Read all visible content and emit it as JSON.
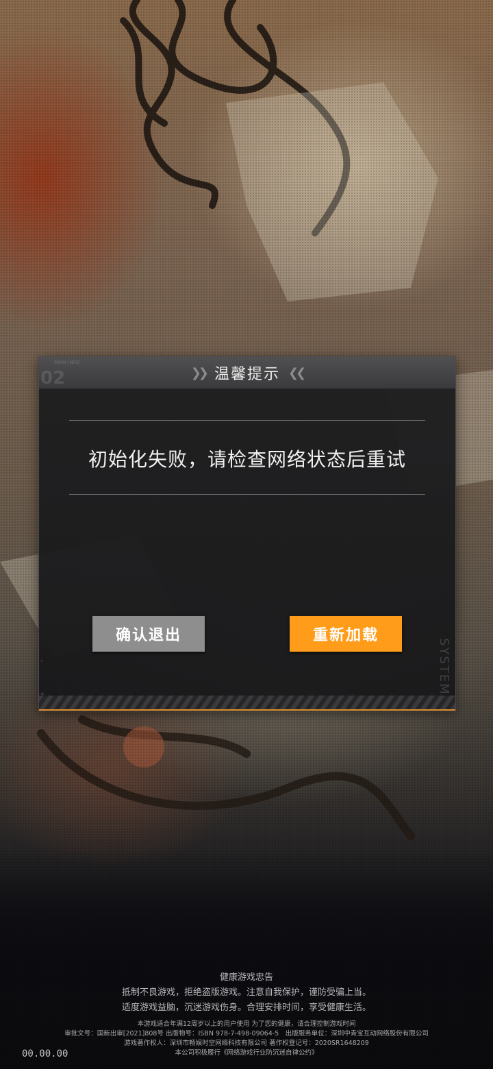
{
  "dialog": {
    "title": "温馨提示",
    "header_number": "02",
    "header_tag": "MAIN INFO",
    "message": "初始化失败，请检查网络状态后重试",
    "exit_button": "确认退出",
    "reload_button": "重新加载",
    "side_label": "SYSTEM"
  },
  "footer": {
    "notice_title": "健康游戏忠告",
    "notice_line1": "抵制不良游戏，拒绝盗版游戏。注意自我保护，谨防受骗上当。",
    "notice_line2": "适度游戏益脑，沉迷游戏伤身。合理安排时间，享受健康生活。",
    "age_notice": "本游戏适合年满12周岁以上的用户使用 为了您的健康，请合理控制游戏时间",
    "approval": "审批文号：国新出审[2021]808号 出版物号：ISBN 978-7-498-09064-5　出版服务单位：深圳中青宝互动网络股份有限公司",
    "copyright": "游戏著作权人：深圳市畅娱时空网络科技有限公司 著作权登记号：2020SR1648209",
    "pledge": "本公司积极履行《网络游戏行业防沉迷自律公约》"
  },
  "version": "00.00.00",
  "colors": {
    "accent": "#ff9c1a",
    "exit_button_bg": "#8e8e8e",
    "dialog_bg": "#1e1e20"
  }
}
